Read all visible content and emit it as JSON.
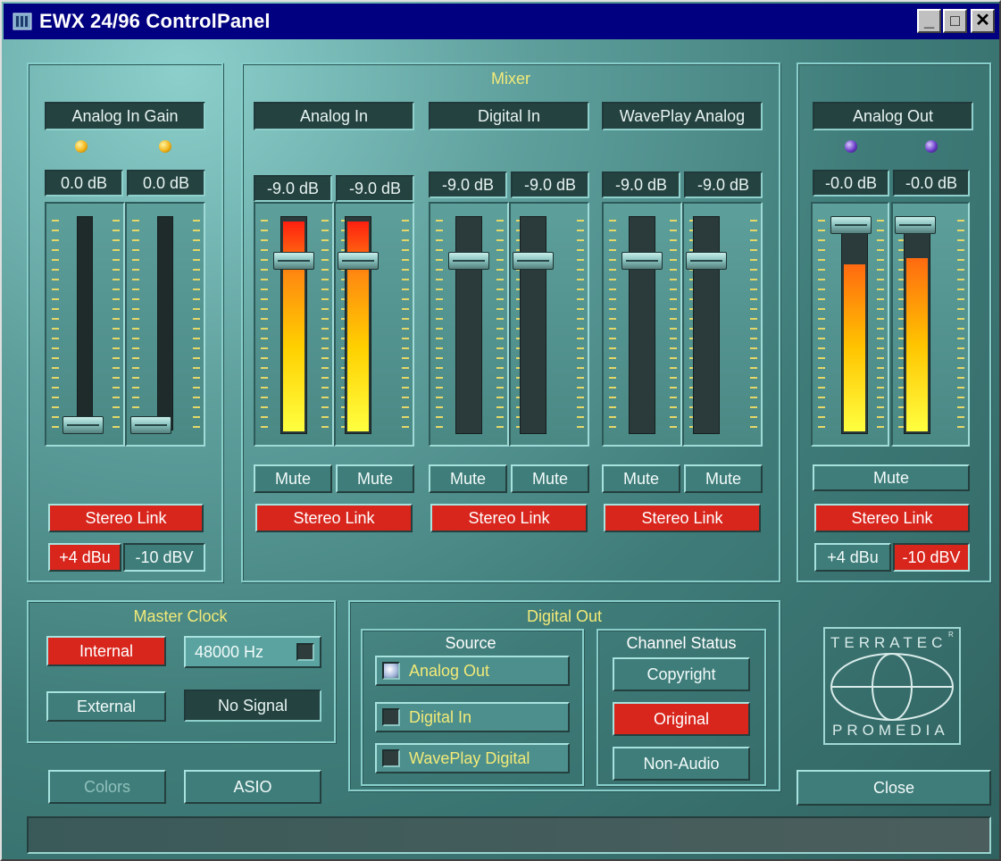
{
  "window": {
    "title": "EWX 24/96 ControlPanel",
    "app_icon": "speaker-panel-icon",
    "minimize": "_",
    "maximize": "□",
    "close": "✕"
  },
  "analog_in_gain": {
    "title": "Analog In Gain",
    "left_db": "0.0 dB",
    "right_db": "0.0 dB",
    "left_level": 0.0,
    "right_level": 0.0,
    "stereo_link": "Stereo Link",
    "ref_plus4": "+4 dBu",
    "ref_minus10": "-10 dBV",
    "selected_ref": "+4 dBu"
  },
  "mixer": {
    "title": "Mixer",
    "channels": [
      {
        "name": "Analog In",
        "left_db": "-9.0 dB",
        "right_db": "-9.0 dB",
        "mute_l": "Mute",
        "mute_r": "Mute",
        "stereo_link": "Stereo Link",
        "fader_level": 0.82,
        "meter_level": 0.98
      },
      {
        "name": "Digital In",
        "left_db": "-9.0 dB",
        "right_db": "-9.0 dB",
        "mute_l": "Mute",
        "mute_r": "Mute",
        "stereo_link": "Stereo Link",
        "fader_level": 0.82,
        "meter_level": 0.0
      },
      {
        "name": "WavePlay Analog",
        "left_db": "-9.0 dB",
        "right_db": "-9.0 dB",
        "mute_l": "Mute",
        "mute_r": "Mute",
        "stereo_link": "Stereo Link",
        "fader_level": 0.82,
        "meter_level": 0.0
      }
    ]
  },
  "analog_out": {
    "title": "Analog Out",
    "left_db": "-0.0 dB",
    "right_db": "-0.0 dB",
    "fader_level": 1.0,
    "meter_left": 0.78,
    "meter_right": 0.81,
    "mute": "Mute",
    "stereo_link": "Stereo Link",
    "ref_plus4": "+4 dBu",
    "ref_minus10": "-10 dBV",
    "selected_ref": "-10 dBV"
  },
  "master_clock": {
    "title": "Master Clock",
    "internal": "Internal",
    "external": "External",
    "rate": "48000 Hz",
    "signal": "No Signal",
    "selected": "Internal"
  },
  "digital_out": {
    "title": "Digital Out",
    "source_title": "Source",
    "sources": [
      "Analog Out",
      "Digital In",
      "WavePlay Digital"
    ],
    "selected_source": "Analog Out",
    "channel_status_title": "Channel Status",
    "copyright": "Copyright",
    "original": "Original",
    "non_audio": "Non-Audio"
  },
  "footer": {
    "colors": "Colors",
    "asio": "ASIO",
    "close": "Close"
  },
  "logo": {
    "top": "TERRATEC",
    "bottom": "PROMEDIA",
    "mark": "R"
  },
  "colors": {
    "accent_red": "#d8261d",
    "label_yellow": "#f2ea78",
    "title_blue": "#000080"
  }
}
